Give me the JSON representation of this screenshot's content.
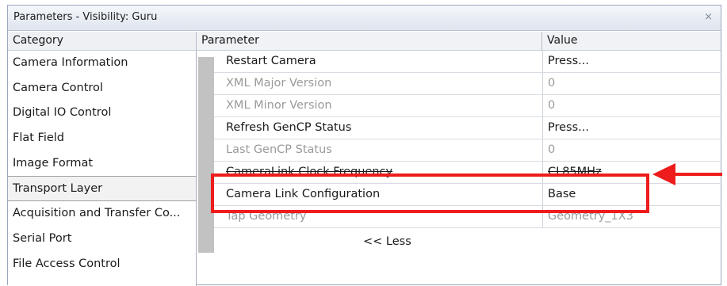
{
  "window": {
    "title": "Parameters - Visibility: Guru",
    "close_glyph": "×"
  },
  "columns": {
    "category": "Category",
    "parameter": "Parameter",
    "value": "Value"
  },
  "categories": [
    {
      "label": "Camera Information"
    },
    {
      "label": "Camera Control"
    },
    {
      "label": "Digital IO Control"
    },
    {
      "label": "Flat Field"
    },
    {
      "label": "Image Format"
    },
    {
      "label": "Transport Layer",
      "selected": true
    },
    {
      "label": "Acquisition and Transfer Co..."
    },
    {
      "label": "Serial Port"
    },
    {
      "label": "File Access Control"
    }
  ],
  "parameters": [
    {
      "name": "Restart Camera",
      "value": "Press...",
      "enabled": true
    },
    {
      "name": "XML Major Version",
      "value": "0",
      "enabled": false
    },
    {
      "name": "XML Minor Version",
      "value": "0",
      "enabled": false
    },
    {
      "name": "Refresh GenCP Status",
      "value": "Press...",
      "enabled": true
    },
    {
      "name": "Last GenCP Status",
      "value": "0",
      "enabled": false
    },
    {
      "name": "CameraLink Clock Frequency",
      "value": "CL85MHz",
      "enabled": true
    },
    {
      "name": "Camera Link Configuration",
      "value": "Base",
      "enabled": true,
      "highlighted": true
    },
    {
      "name": "Tap Geometry",
      "value": "Geometry_1X3",
      "enabled": false
    }
  ],
  "less_button": "<< Less",
  "annotation": {
    "color": "#ee1c1c"
  }
}
